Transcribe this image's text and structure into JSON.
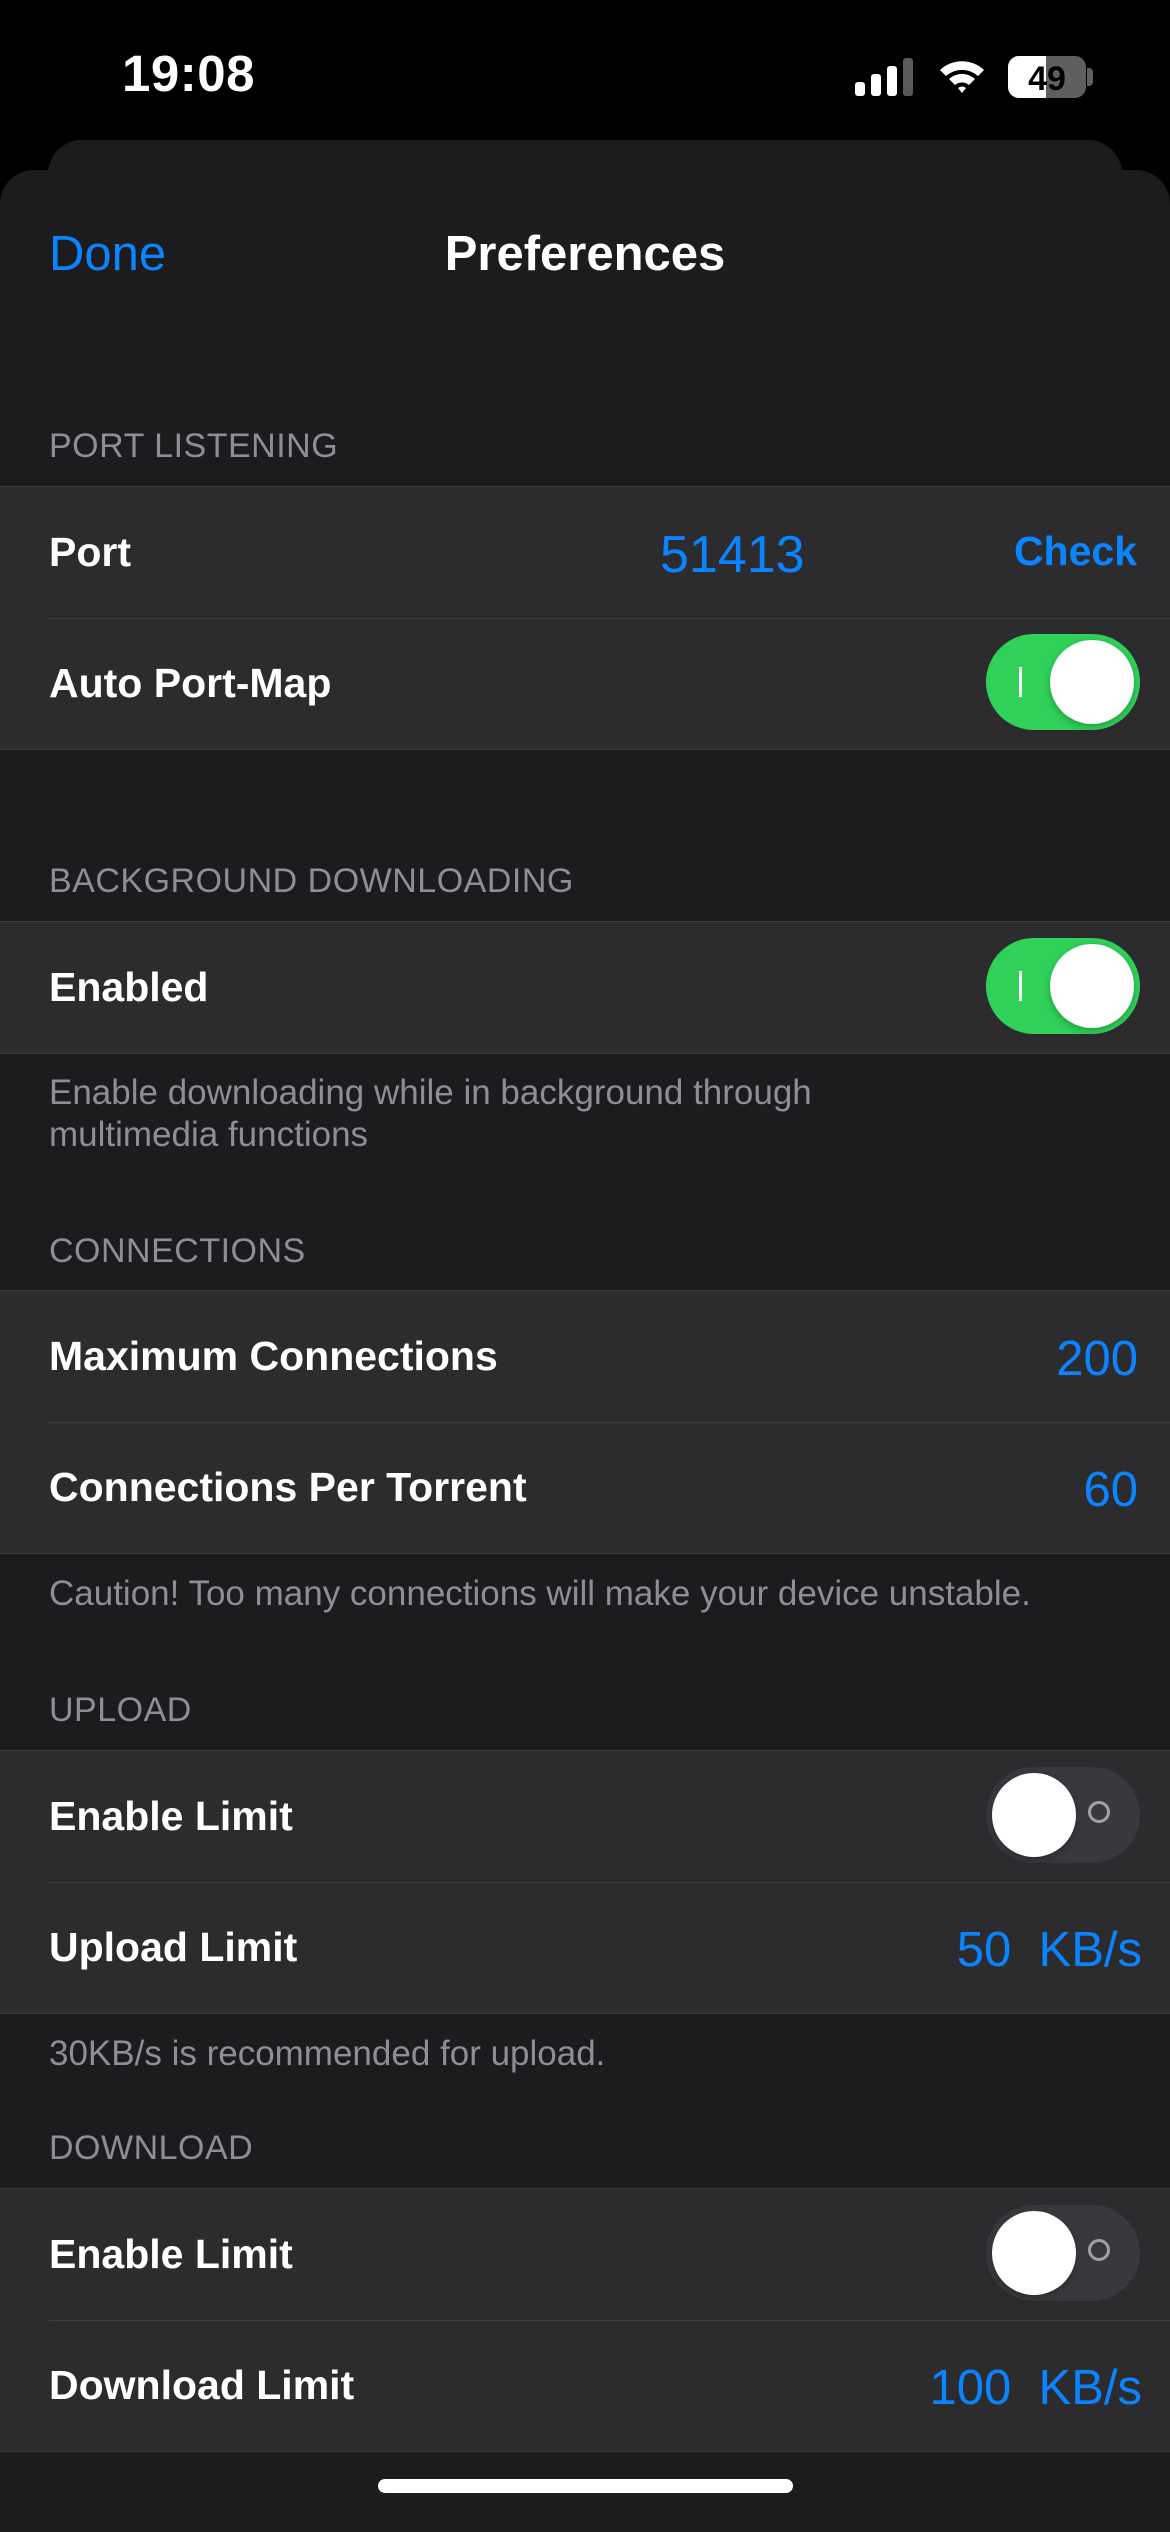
{
  "status_bar": {
    "time": "19:08",
    "battery": "49",
    "battery_fill_percent": 49
  },
  "nav": {
    "done_label": "Done",
    "title": "Preferences"
  },
  "port_listening": {
    "header": "PORT LISTENING",
    "port_label": "Port",
    "port_value": "51413",
    "check_label": "Check",
    "auto_port_map_label": "Auto Port-Map",
    "auto_port_map_on": true
  },
  "background_downloading": {
    "header": "BACKGROUND DOWNLOADING",
    "enabled_label": "Enabled",
    "enabled_on": true,
    "footer": "Enable downloading while in background through multimedia functions"
  },
  "connections": {
    "header": "CONNECTIONS",
    "max_label": "Maximum Connections",
    "max_value": "200",
    "per_torrent_label": "Connections Per Torrent",
    "per_torrent_value": "60",
    "footer": "Caution! Too many connections will make your device unstable."
  },
  "upload": {
    "header": "UPLOAD",
    "enable_limit_label": "Enable Limit",
    "enable_limit_on": false,
    "limit_label": "Upload Limit",
    "limit_value": "50  KB/s",
    "footer": "30KB/s is recommended for upload."
  },
  "download": {
    "header": "DOWNLOAD",
    "enable_limit_label": "Enable Limit",
    "enable_limit_on": false,
    "limit_label": "Download Limit",
    "limit_value": "100  KB/s"
  },
  "colors": {
    "accent": "#0a84ff",
    "toggle_on": "#30d158",
    "background": "#1c1c1e",
    "cell": "#2c2c2e"
  }
}
